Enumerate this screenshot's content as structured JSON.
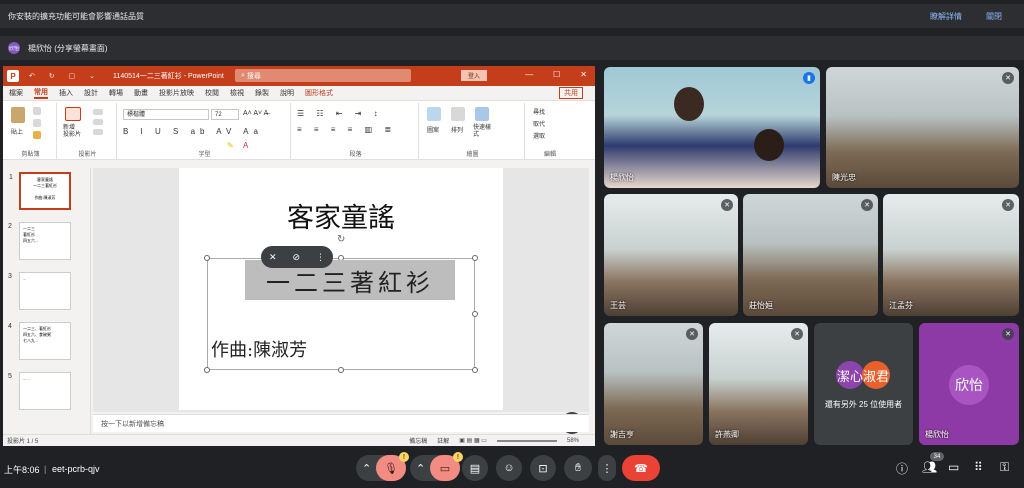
{
  "notice": {
    "text": "你安裝的擴充功能可能會影響通話品質",
    "details": "瞭解詳情",
    "close": "關閉"
  },
  "presenter": {
    "label": "楊欣怡 (分享螢幕畫面)",
    "avatar": "欣怡"
  },
  "ppt": {
    "quick": "↶ ↻ ▢ ⌄",
    "doc_title": "1140514一二三著紅衫 - PowerPoint",
    "search": "搜尋",
    "signin": "登入",
    "win": [
      "—",
      "☐",
      "✕"
    ],
    "tabs": [
      "檔案",
      "常用",
      "插入",
      "設計",
      "轉場",
      "動畫",
      "投影片放映",
      "校閱",
      "檢視",
      "錄製",
      "說明",
      "圖形格式"
    ],
    "share": "共用",
    "groups": {
      "clipboard": "剪貼簿",
      "slides": "投影片",
      "font": "字型",
      "para": "段落",
      "drawing": "繪圖",
      "editing": "編輯"
    },
    "ribbon": {
      "paste": "貼上",
      "new_slide": "新增\n投影片",
      "font_name": "標楷體",
      "font_size": "72",
      "shapes": "圖案",
      "arrange": "排列",
      "quick_styles": "快速樣\n式",
      "find": "尋找",
      "replace": "取代",
      "select": "選取"
    },
    "slides": [
      {
        "num": "1",
        "text": "客家童謠\n一二三著紅衫\n\n作曲:陳淑芳"
      },
      {
        "num": "2",
        "text": "一二三\n著紅衫\n四五六..."
      },
      {
        "num": "3",
        "text": "..."
      },
      {
        "num": "4",
        "text": "一二三、著紅衫\n四五六、食碗粥\n七八九..."
      },
      {
        "num": "5",
        "text": "......"
      }
    ],
    "slide": {
      "title": "客家童謠",
      "subtitle": "一二三著紅衫",
      "composer": "作曲:陳淑芳"
    },
    "notes_placeholder": "按一下以新增備忘稿",
    "status": {
      "page": "投影片 1 / 5",
      "notes": "備忘稿",
      "comments": "註解",
      "zoom": "58%"
    }
  },
  "tiles": [
    {
      "name": "楊欣怡"
    },
    {
      "name": "陳光忠"
    },
    {
      "name": "王芸"
    },
    {
      "name": "莊怡姮"
    },
    {
      "name": "江孟芬"
    },
    {
      "name": "謝吉亨"
    },
    {
      "name": "許燕卿"
    }
  ],
  "others": {
    "av1": "潔心",
    "av2": "淑君",
    "text": "還有另外 25 位使用者",
    "av1_color": "#8e44ad",
    "av2_color": "#e8612c"
  },
  "self": {
    "avatar": "欣怡",
    "name": "楊欣怡",
    "color": "#8e3aa6"
  },
  "controls": {
    "time": "上午8:06",
    "code": "eet-pcrb-qjv",
    "participants": "34"
  }
}
